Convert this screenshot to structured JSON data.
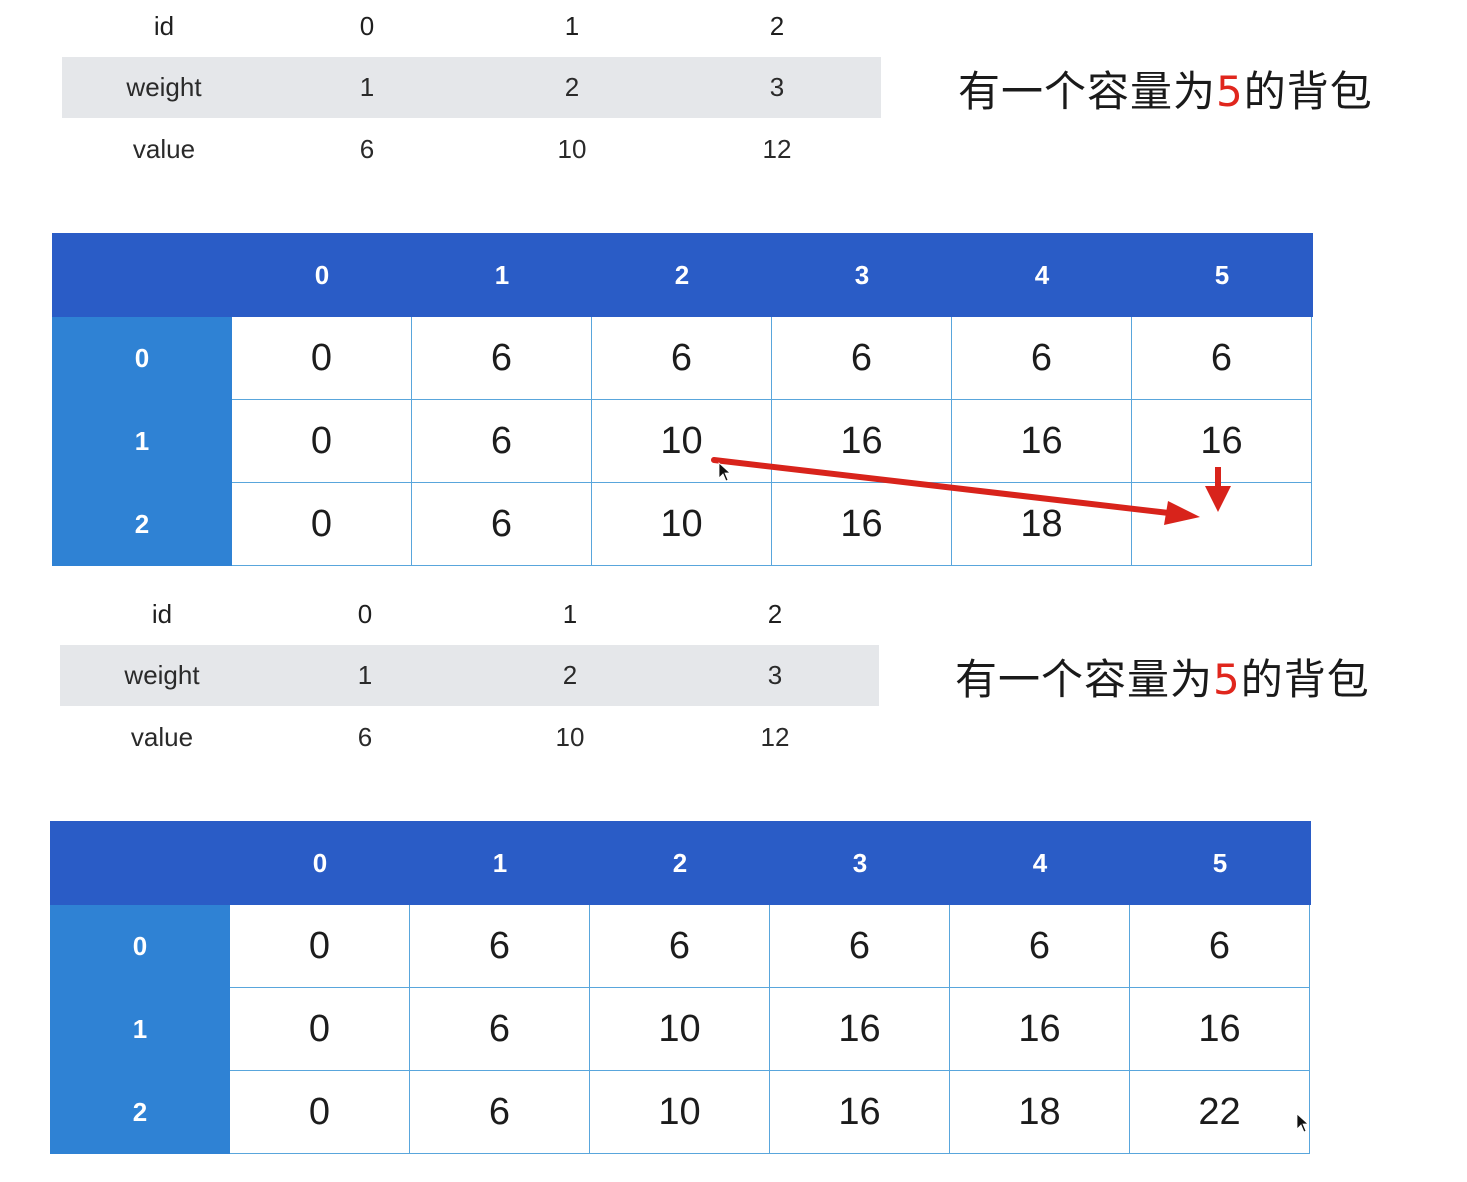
{
  "items": {
    "row_labels": [
      "id",
      "weight",
      "value"
    ],
    "ids": [
      "0",
      "1",
      "2"
    ],
    "weights": [
      "1",
      "2",
      "3"
    ],
    "values": [
      "6",
      "10",
      "12"
    ]
  },
  "caption": {
    "prefix": "有一个容量为",
    "capacity": "5",
    "suffix": "的背包"
  },
  "grid": {
    "col_headers": [
      "0",
      "1",
      "2",
      "3",
      "4",
      "5"
    ],
    "row_headers": [
      "0",
      "1",
      "2"
    ]
  },
  "panels": [
    {
      "rows": [
        [
          "0",
          "6",
          "6",
          "6",
          "6",
          "6"
        ],
        [
          "0",
          "6",
          "10",
          "16",
          "16",
          "16"
        ],
        [
          "0",
          "6",
          "10",
          "16",
          "18",
          ""
        ]
      ],
      "annotation": {
        "from_cell": [
          1,
          2
        ],
        "to_cell": [
          2,
          5
        ],
        "color": "#d8231b"
      }
    },
    {
      "rows": [
        [
          "0",
          "6",
          "6",
          "6",
          "6",
          "6"
        ],
        [
          "0",
          "6",
          "10",
          "16",
          "16",
          "16"
        ],
        [
          "0",
          "6",
          "10",
          "16",
          "18",
          "22"
        ]
      ]
    }
  ],
  "colors": {
    "header_bg": "#2a5cc6",
    "side_bg": "#2f82d4",
    "grid_line": "#59a6dc",
    "weight_row_bg": "#e5e7ea",
    "accent_red": "#e0261d"
  }
}
